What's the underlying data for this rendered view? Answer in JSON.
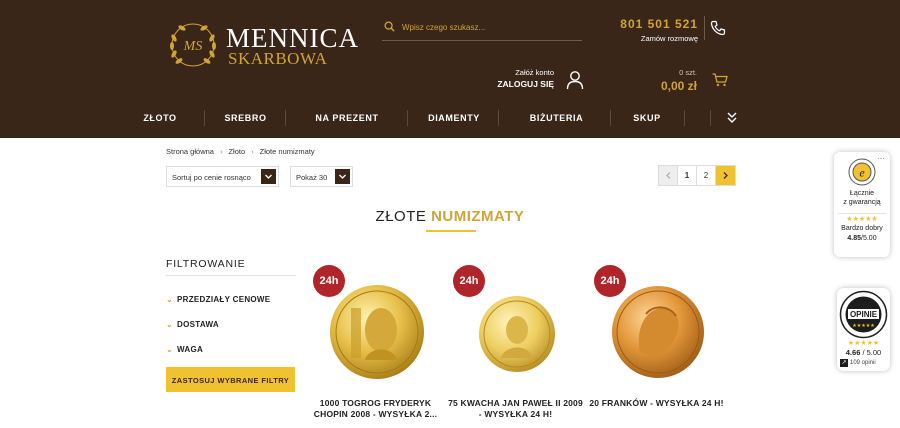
{
  "brand": {
    "line1": "MENNICA",
    "line2": "SKARBOWA"
  },
  "search": {
    "placeholder": "Wpisz czego szukasz..."
  },
  "contact": {
    "phone": "801 501 521",
    "callback": "Zamów rozmowę"
  },
  "account": {
    "create": "Załóż konto",
    "login": "ZALOGUJ SIĘ"
  },
  "cart": {
    "count": "0 szt.",
    "total": "0,00 zł"
  },
  "nav": [
    "ZŁOTO",
    "SREBRO",
    "NA PREZENT",
    "DIAMENTY",
    "BIŻUTERIA",
    "SKUP"
  ],
  "breadcrumb": [
    "Strona główna",
    "Złoto",
    "Złote numizmaty"
  ],
  "sort": {
    "label": "Sortuj po cenie rosnąco"
  },
  "perpage": {
    "label": "Pokaż 30"
  },
  "pagination": {
    "pages": [
      "1",
      "2"
    ]
  },
  "page_title": {
    "a": "ZŁOTE ",
    "b": "NUMIZMATY"
  },
  "filters": {
    "title": "FILTROWANIE",
    "items": [
      "PRZEDZIAŁY CENOWE",
      "DOSTAWA",
      "WAGA"
    ],
    "apply": "ZASTOSUJ WYBRANE FILTRY"
  },
  "products": [
    {
      "badge": "24h",
      "name": "1000 TOGROG FRYDERYK CHOPIN 2008 - WYSYŁKA 2...",
      "coin": "gold-proof-coin"
    },
    {
      "badge": "24h",
      "name": "75 KWACHA JAN PAWEŁ II 2009 - WYSYŁKA 24 H!",
      "coin": "gold-proof-coin"
    },
    {
      "badge": "24h",
      "name": "20 FRANKÓW - WYSYŁKA 24 H!",
      "coin": "gold-circulated-coin"
    }
  ],
  "trust": {
    "widget1": {
      "line1": "Łącznie",
      "line2": "z gwarancją",
      "rating_label": "Bardzo dobry",
      "rating": "4.85",
      "max": "/5.00"
    },
    "widget2": {
      "brand": "OPINIE",
      "rating": "4.66",
      "max": "/ 5.00",
      "count": "109 opinii"
    }
  },
  "colors": {
    "header": "#3a2619",
    "gold": "#d1a437",
    "accent": "#f0c230",
    "badge": "#b0252a"
  }
}
